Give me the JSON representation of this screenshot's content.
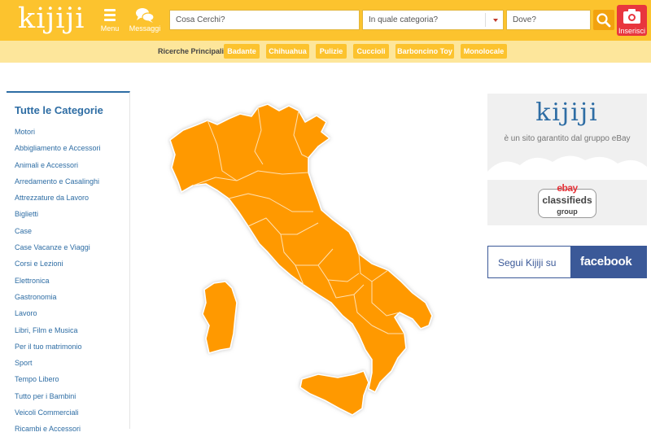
{
  "header": {
    "logo": "kijiji",
    "menu_label": "Menu",
    "messages_label": "Messaggi",
    "insert_label": "Inserisci",
    "search_what_placeholder": "Cosa Cerchi?",
    "search_category_placeholder": "In quale categoria?",
    "search_where_placeholder": "Dove?"
  },
  "popular": {
    "title": "Ricerche Principali",
    "chips": [
      "Badante",
      "Chihuahua",
      "Pulizie",
      "Cuccioli",
      "Barboncino Toy",
      "Monolocale"
    ]
  },
  "sidebar": {
    "title": "Tutte le Categorie",
    "items": [
      "Motori",
      "Abbigliamento e Accessori",
      "Animali e Accessori",
      "Arredamento e Casalinghi",
      "Attrezzature da Lavoro",
      "Biglietti",
      "Case",
      "Case Vacanze e Viaggi",
      "Corsi e Lezioni",
      "Elettronica",
      "Gastronomia",
      "Lavoro",
      "Libri, Film e Musica",
      "Per il tuo matrimonio",
      "Sport",
      "Tempo Libero",
      "Tutto per i Bambini",
      "Veicoli Commerciali",
      "Ricambi e Accessori"
    ]
  },
  "ebay_box": {
    "logo": "kijiji",
    "subtitle": "è un sito garantito dal gruppo eBay",
    "badge_top": "ebay",
    "badge_mid": "classifieds",
    "badge_bottom": "group"
  },
  "facebook": {
    "left_text": "Segui Kijiji su",
    "right_text": "facebook"
  },
  "colors": {
    "brand_yellow": "#fcc32e",
    "map_orange": "#ff9900",
    "link_blue": "#2e6da4",
    "facebook_blue": "#3b5998",
    "insert_red": "#e8363e"
  }
}
